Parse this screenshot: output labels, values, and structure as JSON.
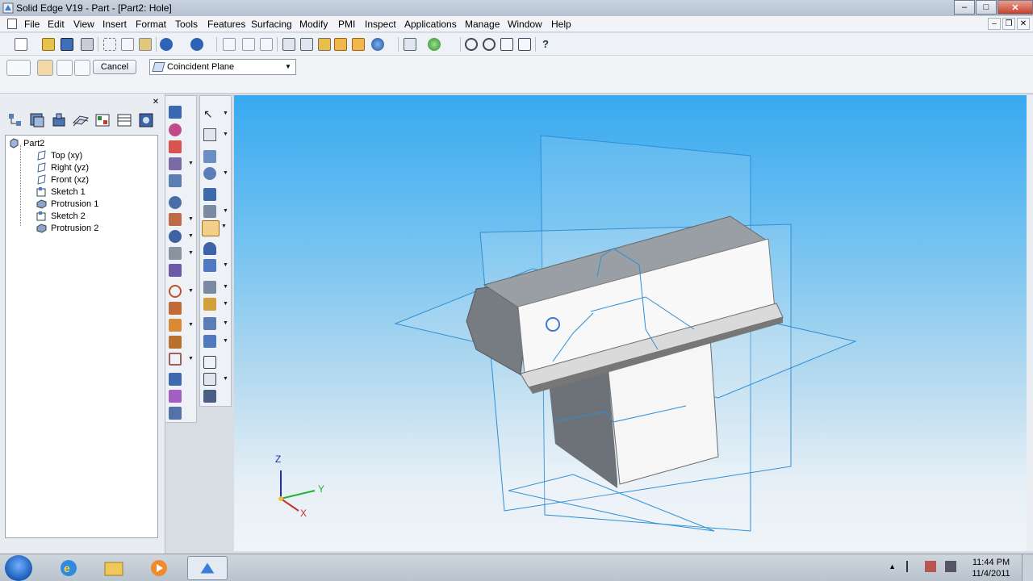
{
  "window": {
    "title": "Solid Edge V19 - Part - [Part2: Hole]"
  },
  "menu": {
    "items": [
      "File",
      "Edit",
      "View",
      "Insert",
      "Format",
      "Tools",
      "Features",
      "Surfacing",
      "Modify",
      "PMI",
      "Inspect",
      "Applications",
      "Manage",
      "Window",
      "Help"
    ]
  },
  "command_bar": {
    "cancel_label": "Cancel",
    "plane_option": "Coincident Plane"
  },
  "pathfinder": {
    "root": "Part2",
    "items": [
      "Top (xy)",
      "Right (yz)",
      "Front (xz)",
      "Sketch 1",
      "Protrusion 1",
      "Sketch 2",
      "Protrusion 2"
    ]
  },
  "triad": {
    "z": "Z",
    "y": "Y",
    "x": "X"
  },
  "taskbar": {
    "time": "11:44 PM",
    "date": "11/4/2011"
  },
  "colors": {
    "viewport_top": "#38a9f0",
    "viewport_bottom": "#f0f4f8",
    "plane_outline": "#2e8fd6"
  }
}
